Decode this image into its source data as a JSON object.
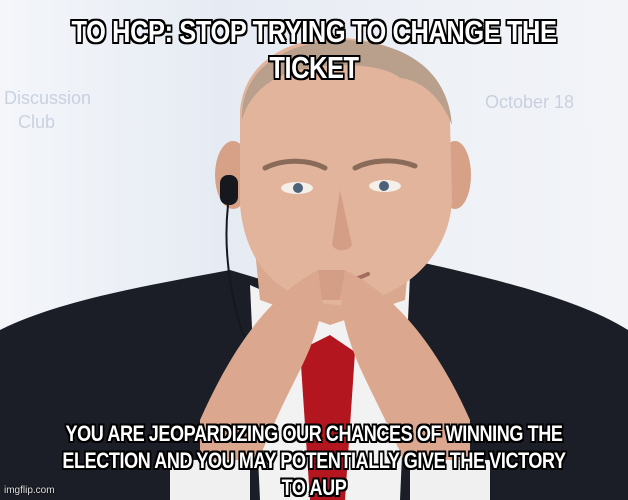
{
  "top_caption": "TO HCP: STOP TRYING TO CHANGE THE TICKET",
  "bottom_caption_line1": "YOU ARE JEOPARDIZING OUR CHANCES OF WINNING THE",
  "bottom_caption_line2": "ELECTION AND YOU MAY POTENTIALLY GIVE THE VICTORY TO AUP",
  "watermark": "imgflip.com",
  "background_text": [
    "Discussion",
    "Club",
    "October 18"
  ],
  "colors": {
    "caption_text": "#ffffff",
    "caption_outline": "#000000",
    "suit": "#1a1d24",
    "tie": "#b3161f",
    "skin": "#e0b49c"
  }
}
